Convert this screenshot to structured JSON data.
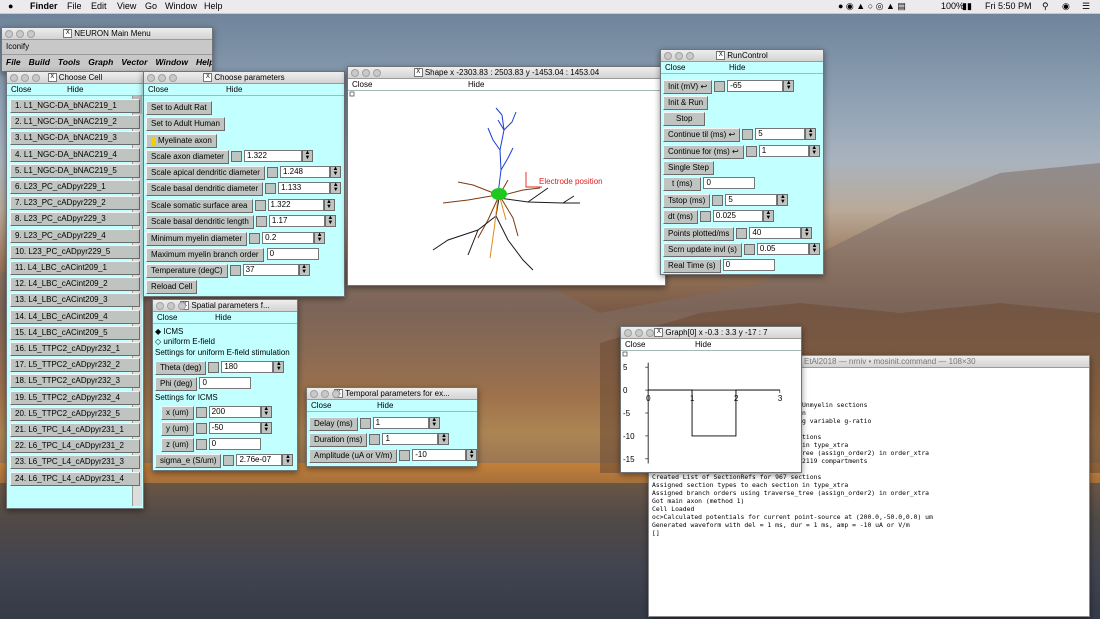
{
  "menubar": {
    "app": "Finder",
    "items": [
      "File",
      "Edit",
      "View",
      "Go",
      "Window",
      "Help"
    ],
    "battery": "100%",
    "clock": "Fri 5:50 PM"
  },
  "neuron_main": {
    "title": "NEURON Main Menu",
    "iconify": "Iconify",
    "menus": [
      "File",
      "Build",
      "Tools",
      "Graph",
      "Vector",
      "Window",
      "Help"
    ]
  },
  "choose_cell": {
    "title": "Choose Cell",
    "close": "Close",
    "hide": "Hide",
    "cells": [
      "1. L1_NGC-DA_bNAC219_1",
      "2. L1_NGC-DA_bNAC219_2",
      "3. L1_NGC-DA_bNAC219_3",
      "4. L1_NGC-DA_bNAC219_4",
      "5. L1_NGC-DA_bNAC219_5",
      "6. L23_PC_cADpyr229_1",
      "7. L23_PC_cADpyr229_2",
      "8. L23_PC_cADpyr229_3",
      "9. L23_PC_cADpyr229_4",
      "10. L23_PC_cADpyr229_5",
      "11. L4_LBC_cACint209_1",
      "12. L4_LBC_cACint209_2",
      "13. L4_LBC_cACint209_3",
      "14. L4_LBC_cACint209_4",
      "15. L4_LBC_cACint209_5",
      "16. L5_TTPC2_cADpyr232_1",
      "17. L5_TTPC2_cADpyr232_2",
      "18. L5_TTPC2_cADpyr232_3",
      "19. L5_TTPC2_cADpyr232_4",
      "20. L5_TTPC2_cADpyr232_5",
      "21. L6_TPC_L4_cADpyr231_1",
      "22. L6_TPC_L4_cADpyr231_2",
      "23. L6_TPC_L4_cADpyr231_3",
      "24. L6_TPC_L4_cADpyr231_4"
    ]
  },
  "choose_params": {
    "title": "Choose parameters",
    "close": "Close",
    "hide": "Hide",
    "adult_rat": "Set to Adult Rat",
    "adult_human": "Set to Adult Human",
    "myelinate": "Myelinate axon",
    "p": [
      {
        "label": "Scale axon diameter",
        "value": "1.322"
      },
      {
        "label": "Scale apical dendritic diameter",
        "value": "1.248"
      },
      {
        "label": "Scale basal dendritic diameter",
        "value": "1.133"
      },
      {
        "label": "Scale somatic surface area",
        "value": "1.322"
      },
      {
        "label": "Scale basal dendritic length",
        "value": "1.17"
      },
      {
        "label": "Minimum myelin diameter",
        "value": "0.2"
      },
      {
        "label": "Maximum myelin branch order",
        "value": "0"
      },
      {
        "label": "Temperature (degC)",
        "value": "37"
      }
    ],
    "reload": "Reload Cell"
  },
  "spatial": {
    "title": "Spatial parameters f...",
    "close": "Close",
    "hide": "Hide",
    "icms": "ICMS",
    "uniform": "uniform E-field",
    "uniform_hdr": "Settings for uniform E-field stimulation",
    "theta_label": "Theta (deg)",
    "theta": "180",
    "phi_label": "Phi (deg)",
    "phi": "0",
    "icms_hdr": "Settings for ICMS",
    "x_label": "x (um)",
    "x": "200",
    "y_label": "y (um)",
    "y": "-50",
    "z_label": "z (um)",
    "z": "0",
    "sigma_label": "sigma_e (S/um)",
    "sigma": "2.76e-07"
  },
  "temporal": {
    "title": "Temporal parameters for ex...",
    "close": "Close",
    "hide": "Hide",
    "delay_label": "Delay (ms)",
    "delay": "1",
    "dur_label": "Duration (ms)",
    "dur": "1",
    "amp_label": "Amplitude (uA or V/m)",
    "amp": "-10"
  },
  "shape": {
    "title": "Shape  x -2303.83 : 2503.83  y -1453.04 : 1453.04",
    "close": "Close",
    "hide": "Hide",
    "electrode": "Electrode position",
    "colors": {
      "axon": "#1a1a1a",
      "apical": "#1a3fd6",
      "soma": "#1ec81e",
      "basal": "#7a3a12",
      "extra": "#e08a1a",
      "electrode": "#e02020"
    }
  },
  "run": {
    "title": "RunControl",
    "close": "Close",
    "hide": "Hide",
    "init_label": "Init (mV)",
    "init": "-65",
    "init_run": "Init & Run",
    "stop": "Stop",
    "cont_til": "Continue til (ms)",
    "cont_til_v": "5",
    "cont_for": "Continue for (ms)",
    "cont_for_v": "1",
    "single": "Single Step",
    "t_label": "t (ms)",
    "t": "0",
    "tstop_label": "Tstop (ms)",
    "tstop": "5",
    "dt_label": "dt (ms)",
    "dt": "0.025",
    "pts_label": "Points plotted/ms",
    "pts": "40",
    "scrn_label": "Scrn update invl (s)",
    "scrn": "0.05",
    "real_label": "Real Time (s)",
    "real": "0"
  },
  "graph": {
    "title": "Graph[0]  x -0.3 : 3.3  y -17 : 7",
    "close": "Close",
    "hide": "Hide"
  },
  "chart_data": {
    "type": "line",
    "x": [
      0,
      1,
      1,
      2,
      2,
      3
    ],
    "y": [
      0,
      0,
      -10,
      -10,
      0,
      0
    ],
    "xlim": [
      -0.3,
      3.3
    ],
    "ylim": [
      -17,
      7
    ],
    "xticks": [
      "0",
      "1",
      "2",
      "3"
    ],
    "yticks": [
      "5",
      "0",
      "-5",
      "-10",
      "-15"
    ]
  },
  "terminal": {
    "title": "EtAl2018 — nrniv • mosinit.command — 108×30",
    "lines": [
      "",
      "",
      "",
      "",
      "",
      "yr232_5",
      "",
      "sections",
      "n in type_xtra",
      "_tree (assign_order2) in order_xtra",
      "",
      "l sections w/ 370 Myelin, 370 Node, 36 Unmyelin sections",
      "Adding myelin before the 1st bifurcation",
      "Scaled diameter of myelin sections using variable g-ratio",
      "numSect was 967",
      "Created List of SectionRefs for 967 sections",
      "Assigned section types to each section in type_xtra",
      "Assigned branch orders using traverse_tree (assign_order2) in order_xtra",
      "Inserted xtra and extracellular in all 2119 compartments",
      "numSect was 967",
      "Created List of SectionRefs for 967 sections",
      "Assigned section types to each section in type_xtra",
      "Assigned branch orders using traverse_tree (assign_order2) in order_xtra",
      "Got main axon (method 1)",
      "Cell Loaded",
      "",
      "oc>Calculated potentials for current point-source at (200.0,-50.0,0.0) um",
      "Generated waveform with del = 1 ms, dur = 1 ms, amp = -10 uA or V/m",
      "[]"
    ]
  }
}
